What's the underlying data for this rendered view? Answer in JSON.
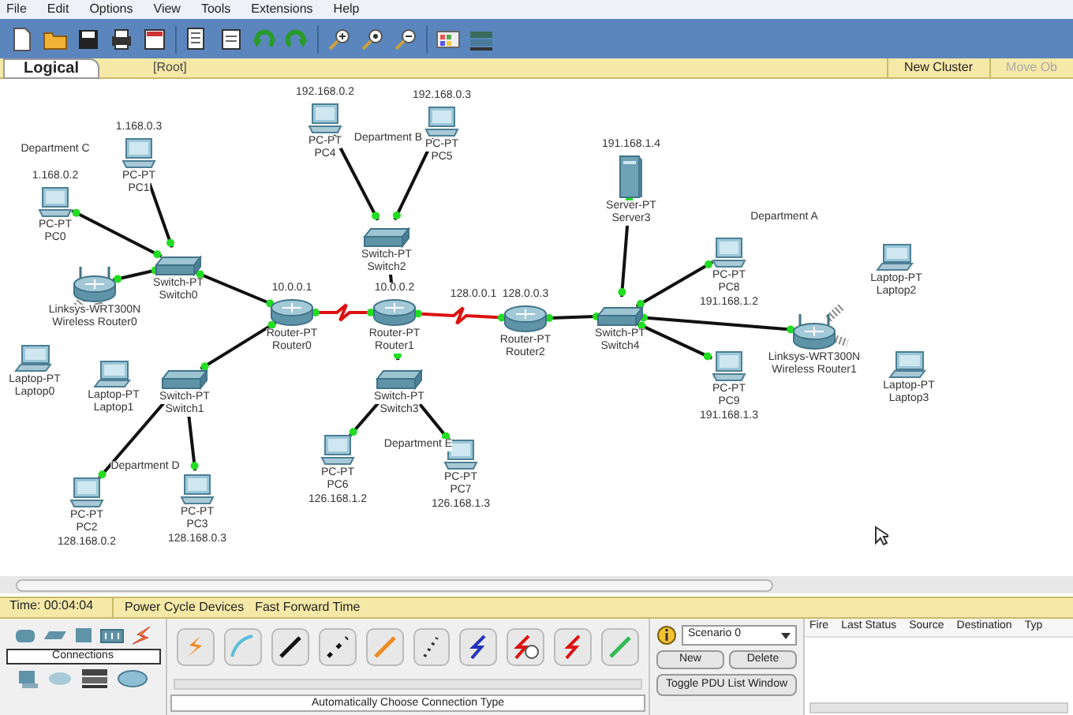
{
  "menu": [
    "File",
    "Edit",
    "Options",
    "View",
    "Tools",
    "Extensions",
    "Help"
  ],
  "workspace": {
    "tab": "Logical",
    "path": "[Root]",
    "buttons": [
      {
        "label": "New Cluster",
        "disabled": false
      },
      {
        "label": "Move Ob",
        "disabled": true
      }
    ]
  },
  "nodes": [
    {
      "kind": "pc",
      "top_text": "1.168.0.2",
      "model": "PC-PT",
      "name": "PC0"
    },
    {
      "kind": "pc",
      "top_text": "1.168.0.3",
      "model": "PC-PT",
      "name": "PC1"
    },
    {
      "kind": "pc",
      "top_text": "192.168.0.2",
      "model": "PC-PT",
      "name": "PC4"
    },
    {
      "kind": "pc",
      "top_text": "192.168.0.3",
      "model": "PC-PT",
      "name": "PC5"
    },
    {
      "kind": "server",
      "top_text": "191.168.1.4",
      "model": "Server-PT",
      "name": "Server3"
    },
    {
      "kind": "wireless_router",
      "model": "Linksys-WRT300N",
      "name": "Wireless Router0"
    },
    {
      "kind": "switch",
      "model": "Switch-PT",
      "name": "Switch0"
    },
    {
      "kind": "switch",
      "model": "Switch-PT",
      "name": "Switch2"
    },
    {
      "kind": "pc",
      "model": "PC-PT",
      "name": "PC8",
      "bottom_text": "191.168.1.2"
    },
    {
      "kind": "laptop",
      "model": "Laptop-PT",
      "name": "Laptop2"
    },
    {
      "kind": "router",
      "top_text": "10.0.0.1",
      "model": "Router-PT",
      "name": "Router0"
    },
    {
      "kind": "router",
      "top_text": "10.0.0.2",
      "model": "Router-PT",
      "name": "Router1"
    },
    {
      "kind": "router",
      "top_text": "128.0.0.3",
      "model": "Router-PT",
      "name": "Router2"
    },
    {
      "kind": "switch",
      "model": "Switch-PT",
      "name": "Switch4"
    },
    {
      "kind": "wireless_router",
      "model": "Linksys-WRT300N",
      "name": "Wireless Router1"
    },
    {
      "kind": "laptop",
      "model": "Laptop-PT",
      "name": "Laptop0"
    },
    {
      "kind": "laptop",
      "model": "Laptop-PT",
      "name": "Laptop1"
    },
    {
      "kind": "switch",
      "model": "Switch-PT",
      "name": "Switch1"
    },
    {
      "kind": "switch",
      "model": "Switch-PT",
      "name": "Switch3"
    },
    {
      "kind": "pc",
      "model": "PC-PT",
      "name": "PC9",
      "bottom_text": "191.168.1.3"
    },
    {
      "kind": "laptop",
      "model": "Laptop-PT",
      "name": "Laptop3"
    },
    {
      "kind": "pc",
      "model": "PC-PT",
      "name": "PC2",
      "bottom_text": "128.168.0.2"
    },
    {
      "kind": "pc",
      "model": "PC-PT",
      "name": "PC3",
      "bottom_text": "128.168.0.3"
    },
    {
      "kind": "pc",
      "model": "PC-PT",
      "name": "PC6",
      "bottom_text": "126.168.1.2"
    },
    {
      "kind": "pc",
      "model": "PC-PT",
      "name": "PC7",
      "bottom_text": "126.168.1.3"
    }
  ],
  "notes": [
    "Department C",
    "Department B",
    "Department A",
    "128.0.0.1",
    "Department E",
    "Department D"
  ],
  "links": [
    {
      "kind": "copper"
    },
    {
      "kind": "copper"
    },
    {
      "kind": "copper"
    },
    {
      "kind": "copper"
    },
    {
      "kind": "serial"
    },
    {
      "kind": "serial"
    },
    {
      "kind": "copper"
    },
    {
      "kind": "copper"
    },
    {
      "kind": "copper"
    },
    {
      "kind": "copper"
    },
    {
      "kind": "copper"
    },
    {
      "kind": "copper"
    },
    {
      "kind": "copper"
    },
    {
      "kind": "copper"
    },
    {
      "kind": "copper"
    },
    {
      "kind": "copper"
    },
    {
      "kind": "copper"
    },
    {
      "kind": "copper"
    },
    {
      "kind": "copper"
    },
    {
      "kind": "copper"
    },
    {
      "kind": "wireless"
    },
    {
      "kind": "wireless"
    },
    {
      "kind": "wireless"
    },
    {
      "kind": "wireless"
    }
  ],
  "realtime_bar": {
    "time": "Time: 00:04:04",
    "buttons": [
      "Power Cycle Devices",
      "Fast Forward Time"
    ]
  },
  "device_panel": {
    "category_label": "Connections",
    "hint": "Automatically Choose Connection Type"
  },
  "scenario": {
    "value": "Scenario 0",
    "buttons": [
      "New",
      "Delete"
    ],
    "toggle": "Toggle PDU List Window"
  },
  "pdu_table": {
    "columns": [
      "Fire",
      "Last Status",
      "Source",
      "Destination",
      "Typ"
    ]
  }
}
